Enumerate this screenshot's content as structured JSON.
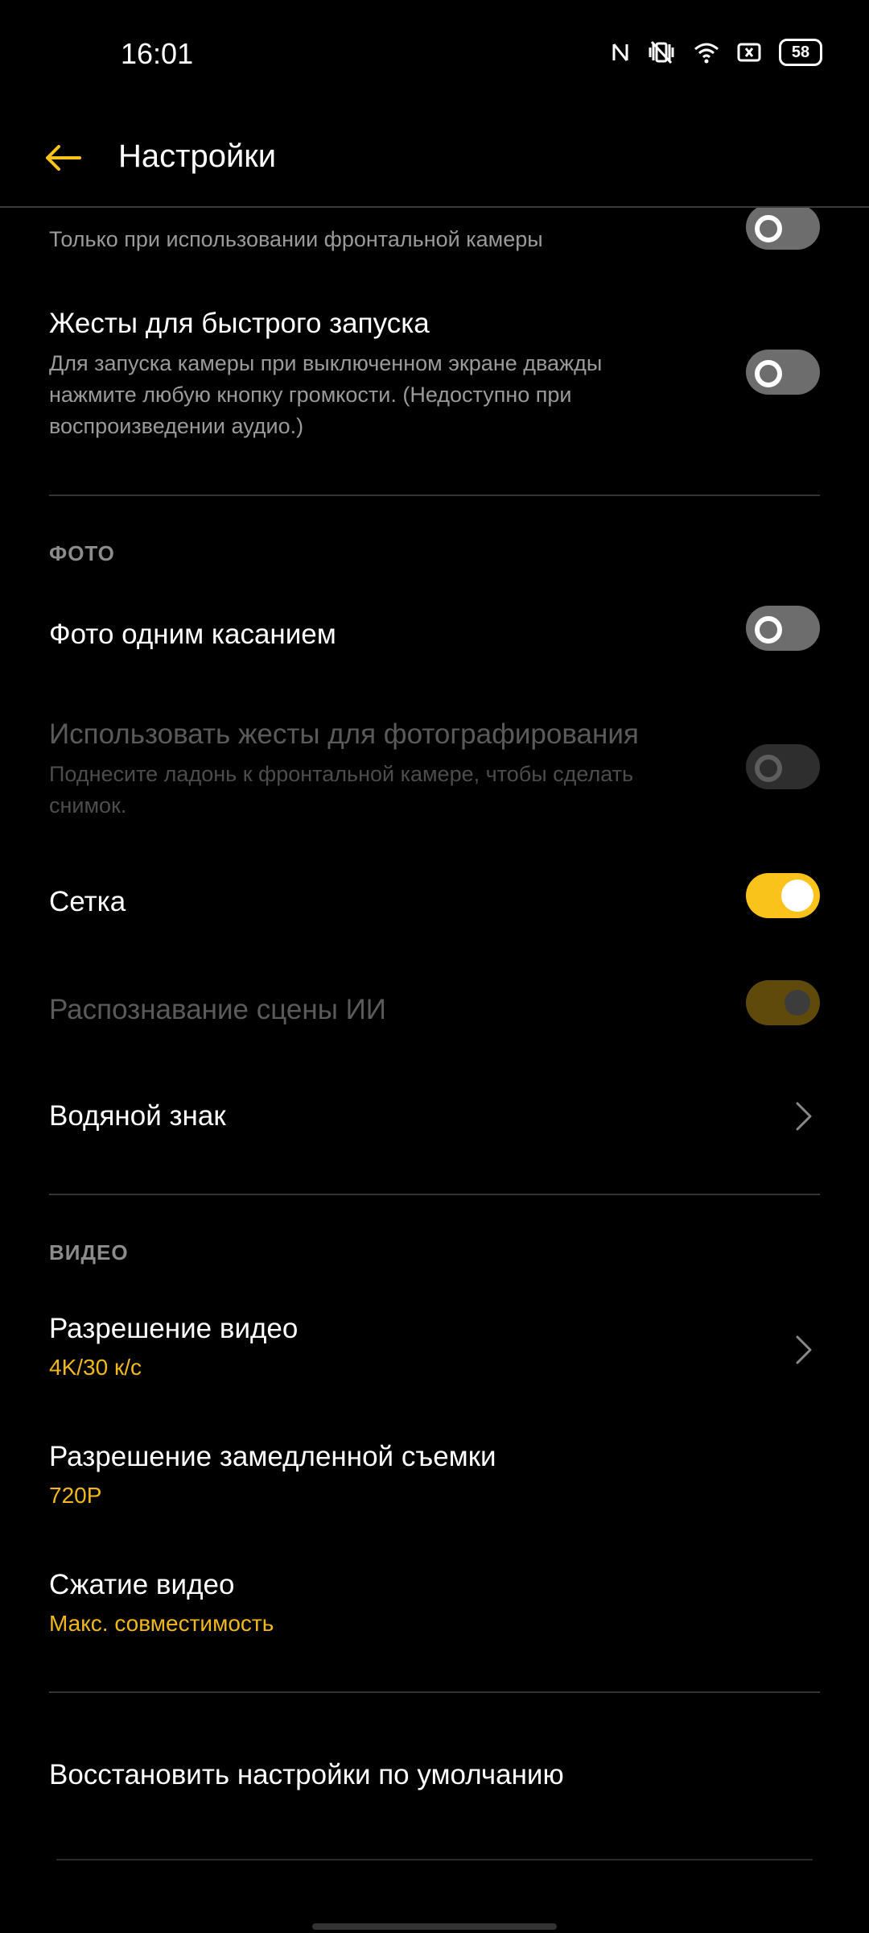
{
  "status_bar": {
    "time": "16:01",
    "battery": "58",
    "icons": [
      "nfc-icon",
      "vibrate-off-icon",
      "wifi-icon",
      "sim-off-icon",
      "battery-icon"
    ]
  },
  "app_bar": {
    "title": "Настройки",
    "back_icon": "arrow-left-icon",
    "accent_color": "#F9C31B"
  },
  "rows": {
    "front_camera_mirror": {
      "subtitle": "Только при использовании фронтальной камеры",
      "toggle": "off"
    },
    "quick_launch": {
      "title": "Жесты для быстрого запуска",
      "subtitle": "Для запуска камеры при выключенном экране дважды нажмите любую кнопку громкости. (Недоступно при воспроизведении аудио.)",
      "toggle": "off"
    },
    "one_touch_photo": {
      "title": "Фото одним касанием",
      "toggle": "off"
    },
    "gesture_photo": {
      "title": "Использовать жесты для фотографирования",
      "subtitle": "Поднесите ладонь к фронтальной камере, чтобы сделать снимок.",
      "toggle": "off",
      "disabled": true
    },
    "grid": {
      "title": "Сетка",
      "toggle": "on"
    },
    "ai_scene": {
      "title": "Распознавание сцены ИИ",
      "toggle": "on",
      "disabled": true
    },
    "watermark": {
      "title": "Водяной знак"
    },
    "video_resolution": {
      "title": "Разрешение видео",
      "value": "4K/30 к/с"
    },
    "slowmo_resolution": {
      "title": "Разрешение замедленной съемки",
      "value": "720P"
    },
    "video_compression": {
      "title": "Сжатие видео",
      "value": "Макс. совместимость"
    },
    "restore_defaults": {
      "title": "Восстановить настройки по умолчанию"
    }
  },
  "sections": {
    "photo": "ФОТО",
    "video": "ВИДЕО"
  }
}
